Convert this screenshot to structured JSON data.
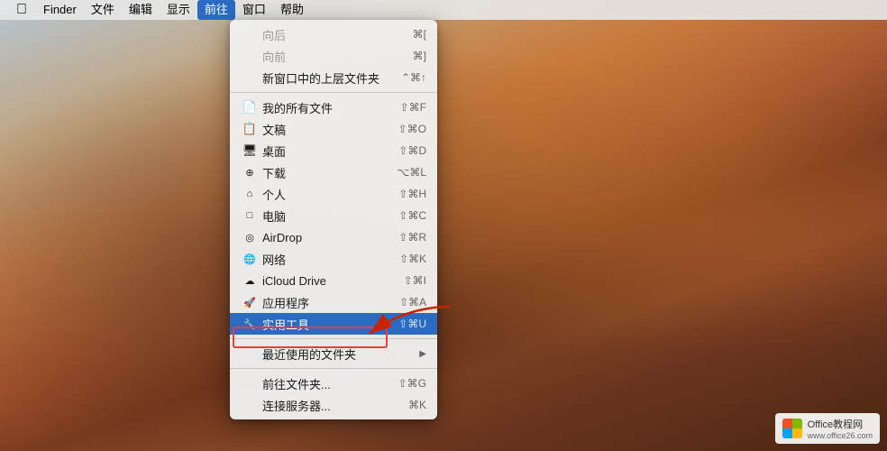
{
  "menubar": {
    "apple": "",
    "items": [
      {
        "id": "finder",
        "label": "Finder"
      },
      {
        "id": "file",
        "label": "文件"
      },
      {
        "id": "edit",
        "label": "编辑"
      },
      {
        "id": "view",
        "label": "显示"
      },
      {
        "id": "go",
        "label": "前往",
        "active": true
      },
      {
        "id": "window",
        "label": "窗口"
      },
      {
        "id": "help",
        "label": "帮助"
      }
    ]
  },
  "dropdown": {
    "items": [
      {
        "id": "back",
        "icon": "",
        "label": "向后",
        "shortcut": "⌘[",
        "disabled": true
      },
      {
        "id": "forward",
        "icon": "",
        "label": "向前",
        "shortcut": "⌘]",
        "disabled": true
      },
      {
        "id": "enclosing",
        "icon": "",
        "label": "新窗口中的上层文件夹",
        "shortcut": "⌃⌘↑"
      },
      {
        "id": "sep1",
        "type": "separator"
      },
      {
        "id": "allfiles",
        "icon": "📄",
        "label": "我的所有文件",
        "shortcut": "⇧⌘F"
      },
      {
        "id": "documents",
        "icon": "📋",
        "label": "文稿",
        "shortcut": "⇧⌘O"
      },
      {
        "id": "desktop",
        "icon": "🖥",
        "label": "桌面",
        "shortcut": "⇧⌘D"
      },
      {
        "id": "downloads",
        "icon": "⬇",
        "label": "下载",
        "shortcut": "⌥⌘L"
      },
      {
        "id": "home",
        "icon": "🏠",
        "label": "个人",
        "shortcut": "⇧⌘H"
      },
      {
        "id": "computer",
        "icon": "💻",
        "label": "电脑",
        "shortcut": "⇧⌘C"
      },
      {
        "id": "airdrop",
        "icon": "📡",
        "label": "AirDrop",
        "shortcut": "⇧⌘R"
      },
      {
        "id": "network",
        "icon": "🌐",
        "label": "网络",
        "shortcut": "⇧⌘K"
      },
      {
        "id": "icloud",
        "icon": "☁",
        "label": "iCloud Drive",
        "shortcut": "⇧⌘I"
      },
      {
        "id": "applications",
        "icon": "🚀",
        "label": "应用程序",
        "shortcut": "⇧⌘A"
      },
      {
        "id": "utilities",
        "icon": "🔧",
        "label": "实用工具",
        "shortcut": "⇧⌘U",
        "highlighted": true
      },
      {
        "id": "sep2",
        "type": "separator"
      },
      {
        "id": "recents",
        "icon": "",
        "label": "最近使用的文件夹",
        "hasArrow": true
      },
      {
        "id": "sep3",
        "type": "separator"
      },
      {
        "id": "gotofolder",
        "icon": "",
        "label": "前往文件夹...",
        "shortcut": "⇧⌘G"
      },
      {
        "id": "connectserver",
        "icon": "",
        "label": "连接服务器...",
        "shortcut": "⌘K"
      }
    ]
  },
  "watermark": {
    "text": "Office教程网",
    "subtext": "www.office26.com"
  }
}
